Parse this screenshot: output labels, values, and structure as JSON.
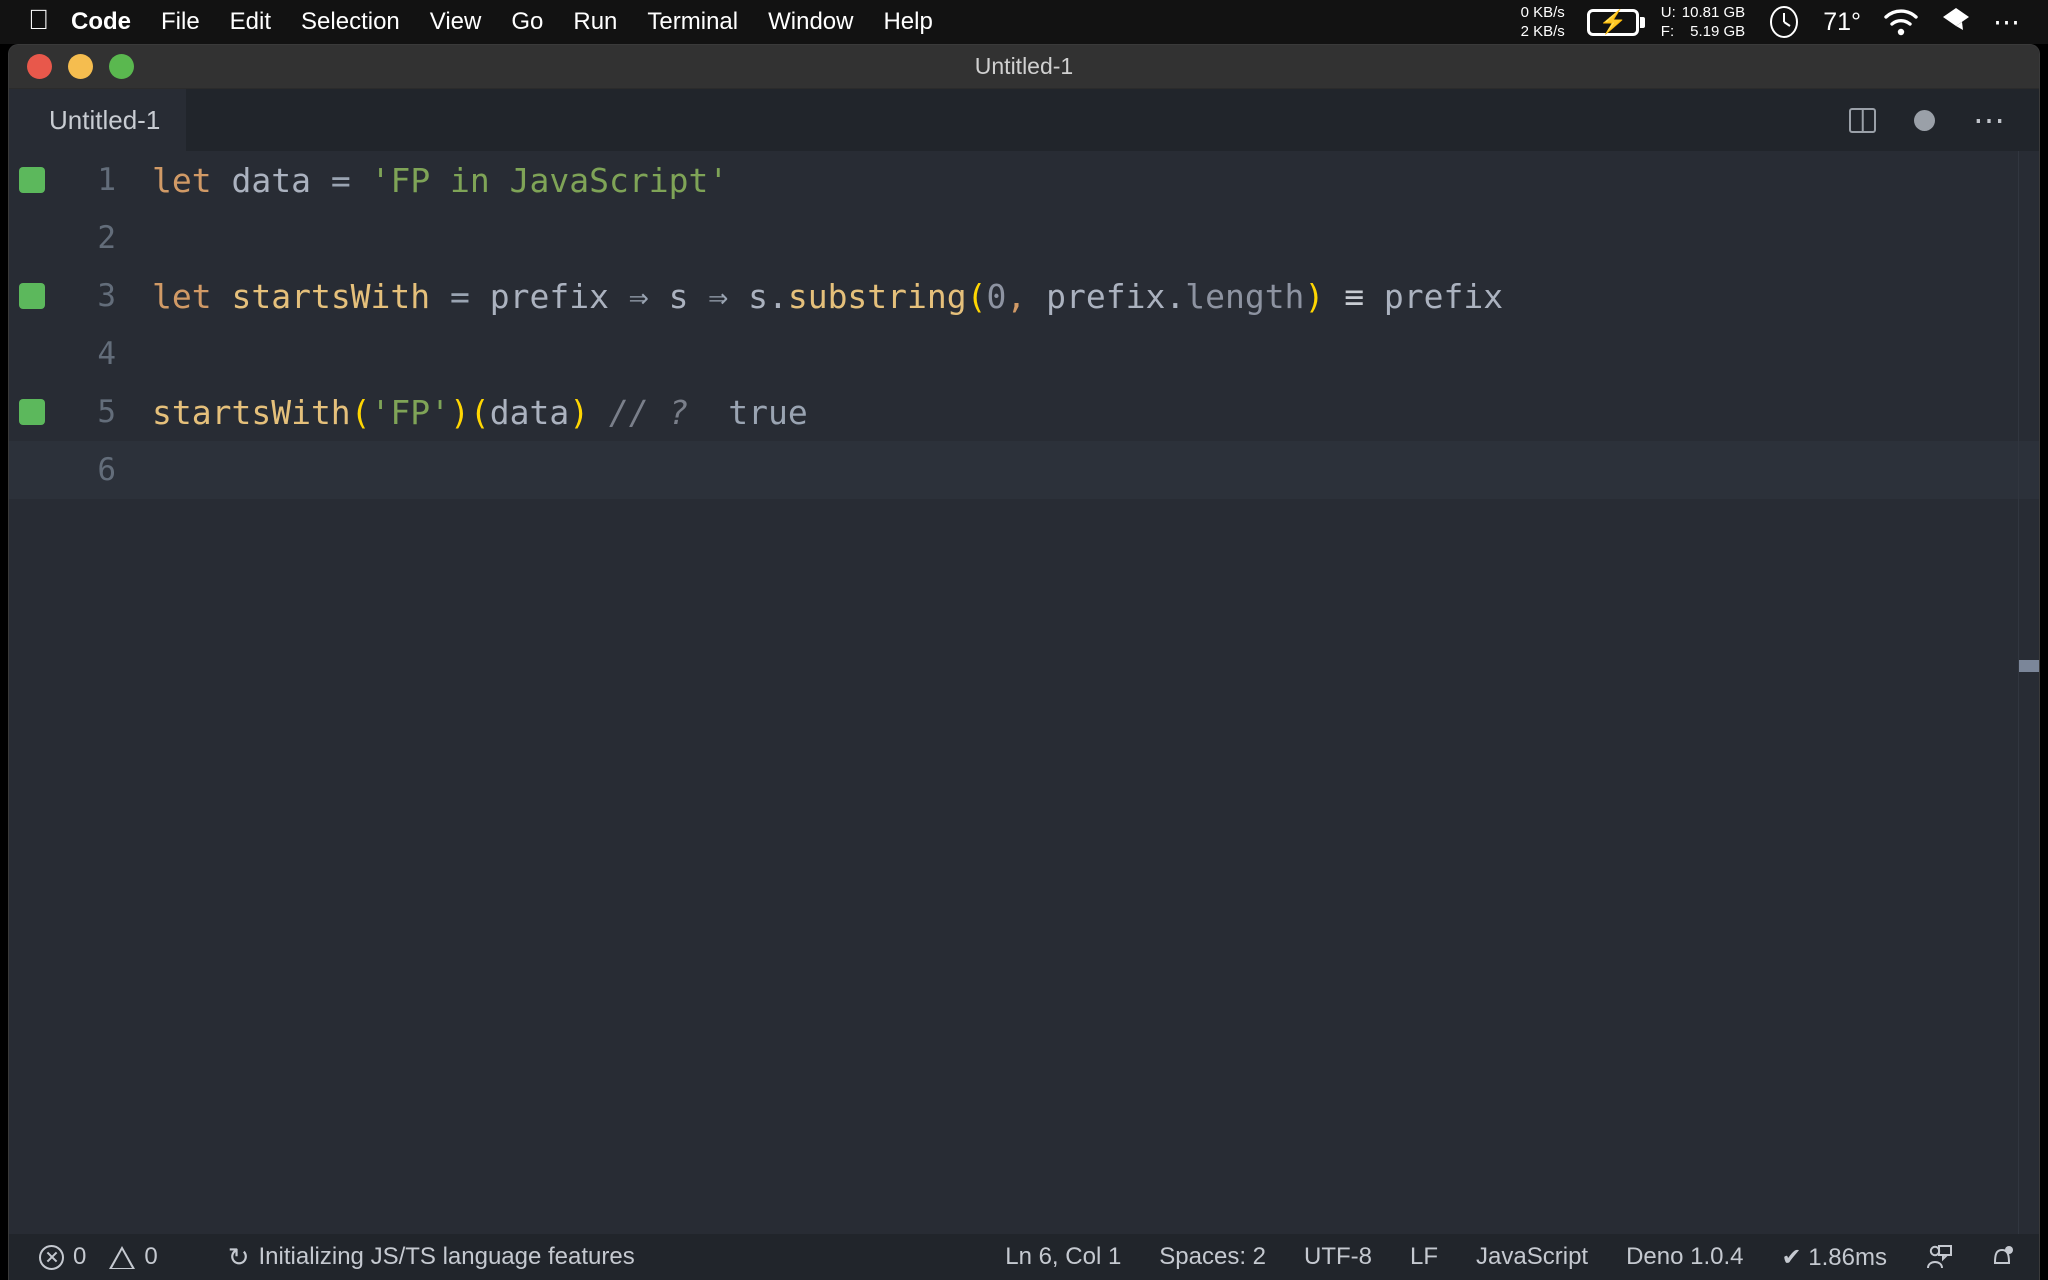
{
  "menubar": {
    "apple_icon": "apple-icon",
    "items": [
      {
        "label": "Code",
        "bold": true
      },
      {
        "label": "File",
        "bold": false
      },
      {
        "label": "Edit",
        "bold": false
      },
      {
        "label": "Selection",
        "bold": false
      },
      {
        "label": "View",
        "bold": false
      },
      {
        "label": "Go",
        "bold": false
      },
      {
        "label": "Run",
        "bold": false
      },
      {
        "label": "Terminal",
        "bold": false
      },
      {
        "label": "Window",
        "bold": false
      },
      {
        "label": "Help",
        "bold": false
      }
    ],
    "status": {
      "net_up": "0 KB/s",
      "net_down": "2 KB/s",
      "battery_icon": "battery-charging-icon",
      "mem_used_label": "U:",
      "mem_free_label": "F:",
      "mem_used_value": "10.81 GB",
      "mem_free_value": "5.19 GB",
      "clock_icon": "analog-clock-icon",
      "temperature": "71°",
      "wifi_icon": "wifi-icon",
      "dropbox_icon": "dropbox-icon",
      "more_icon": "ellipsis-icon"
    }
  },
  "window": {
    "title": "Untitled-1",
    "traffic_lights": [
      "close-button",
      "minimize-button",
      "maximize-button"
    ]
  },
  "tabbar": {
    "tabs": [
      {
        "label": "Untitled-1",
        "active": true
      }
    ],
    "actions": [
      {
        "name": "split-editor-right-icon"
      },
      {
        "name": "unsaved-dot-icon"
      },
      {
        "name": "more-actions-icon",
        "glyph": "⋯"
      }
    ]
  },
  "editor": {
    "language": "javascript",
    "lines": [
      {
        "number": "1",
        "marker": true,
        "current": false,
        "tokens": [
          {
            "t": "kw",
            "v": "let"
          },
          {
            "t": "var",
            "v": " data "
          },
          {
            "t": "op",
            "v": "="
          },
          {
            "t": "var",
            "v": " "
          },
          {
            "t": "str",
            "v": "'FP in JavaScript'"
          }
        ]
      },
      {
        "number": "2",
        "marker": false,
        "current": false,
        "tokens": []
      },
      {
        "number": "3",
        "marker": true,
        "current": false,
        "tokens": [
          {
            "t": "kw",
            "v": "let"
          },
          {
            "t": "fn",
            "v": " startsWith "
          },
          {
            "t": "op",
            "v": "="
          },
          {
            "t": "var",
            "v": " prefix "
          },
          {
            "t": "arrow",
            "v": "⇒"
          },
          {
            "t": "var",
            "v": " s "
          },
          {
            "t": "arrow",
            "v": "⇒"
          },
          {
            "t": "var",
            "v": " s."
          },
          {
            "t": "fn",
            "v": "substring"
          },
          {
            "t": "paren",
            "v": "("
          },
          {
            "t": "num",
            "v": "0"
          },
          {
            "t": "punct",
            "v": ","
          },
          {
            "t": "var",
            "v": " prefix."
          },
          {
            "t": "prop",
            "v": "length"
          },
          {
            "t": "paren",
            "v": ")"
          },
          {
            "t": "var",
            "v": " "
          },
          {
            "t": "eq3",
            "v": "≡"
          },
          {
            "t": "var",
            "v": " prefix"
          }
        ]
      },
      {
        "number": "4",
        "marker": false,
        "current": false,
        "tokens": []
      },
      {
        "number": "5",
        "marker": true,
        "current": false,
        "tokens": [
          {
            "t": "fn",
            "v": "startsWith"
          },
          {
            "t": "paren",
            "v": "("
          },
          {
            "t": "str",
            "v": "'FP'"
          },
          {
            "t": "paren",
            "v": ")("
          },
          {
            "t": "var",
            "v": "data"
          },
          {
            "t": "paren",
            "v": ")"
          },
          {
            "t": "var",
            "v": " "
          },
          {
            "t": "cmt",
            "v": "// ?"
          },
          {
            "t": "var",
            "v": "  "
          },
          {
            "t": "bool",
            "v": "true"
          }
        ]
      },
      {
        "number": "6",
        "marker": false,
        "current": true,
        "tokens": []
      }
    ],
    "overview_marker_top_pct": 47
  },
  "statusbar": {
    "errors_icon": "error-circle-icon",
    "errors_count": "0",
    "warnings_icon": "warning-triangle-icon",
    "warnings_count": "0",
    "task_icon": "sync-spinner-icon",
    "task_text": "Initializing JS/TS language features",
    "right_items": [
      {
        "name": "cursor-position",
        "label": "Ln 6, Col 1"
      },
      {
        "name": "indentation",
        "label": "Spaces: 2"
      },
      {
        "name": "encoding",
        "label": "UTF-8"
      },
      {
        "name": "eol-sequence",
        "label": "LF"
      },
      {
        "name": "language-mode",
        "label": "JavaScript"
      },
      {
        "name": "deno-version",
        "label": "Deno 1.0.4"
      },
      {
        "name": "quokka-timing",
        "label": "✔ 1.86ms"
      }
    ],
    "feedback_icon": "tweet-feedback-icon",
    "bell_icon": "notifications-bell-icon"
  },
  "colors": {
    "editor_bg": "#282c34",
    "chrome_bg": "#21252b",
    "titlebar_bg": "#323232",
    "menubar_bg": "#121212",
    "marker_green": "#5cb85c",
    "keyword": "#d19a66",
    "string": "#7fa457",
    "function": "#e5c07b",
    "paren": "#ffd602",
    "variable": "#abb2bf",
    "comment": "#7a7f8a"
  }
}
